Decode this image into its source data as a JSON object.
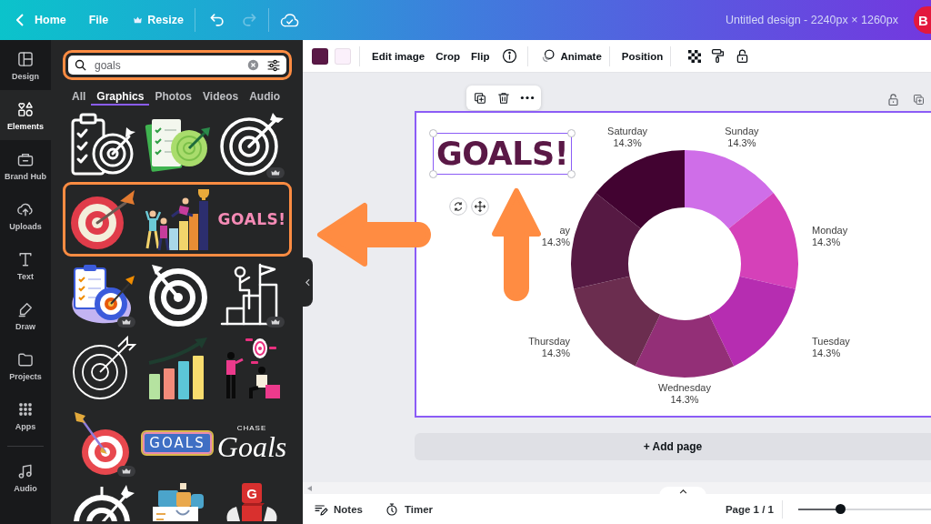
{
  "topbar": {
    "back": "Home",
    "menu": [
      {
        "label": "File"
      }
    ],
    "resize": "Resize",
    "history": [
      {
        "kind": "undo",
        "disabled": false
      },
      {
        "kind": "redo",
        "disabled": true
      }
    ],
    "title": "Untitled design - 2240px × 1260px",
    "avatar": "B"
  },
  "rail": {
    "main": [
      {
        "label": "Design",
        "selected": false
      },
      {
        "label": "Elements",
        "selected": true
      },
      {
        "label": "Brand Hub",
        "selected": false
      },
      {
        "label": "Uploads",
        "selected": false
      },
      {
        "label": "Text",
        "selected": false
      },
      {
        "label": "Draw",
        "selected": false
      },
      {
        "label": "Projects",
        "selected": false
      },
      {
        "label": "Apps",
        "selected": false
      }
    ],
    "extra": [
      {
        "label": "Audio",
        "selected": false
      }
    ]
  },
  "panel": {
    "search": {
      "value": "goals",
      "highlighted": true
    },
    "tabs": [
      {
        "label": "All",
        "selected": false
      },
      {
        "label": "Graphics",
        "selected": true
      },
      {
        "label": "Photos",
        "selected": false
      },
      {
        "label": "Videos",
        "selected": false
      },
      {
        "label": "Audio",
        "selected": false
      }
    ],
    "graphics_rows": [
      {
        "highlighted": false,
        "items": [
          {
            "kind": "clipboard-target",
            "premium": false
          },
          {
            "kind": "paper-target",
            "premium": false
          },
          {
            "kind": "target-outline",
            "premium": true
          }
        ]
      },
      {
        "highlighted": true,
        "items": [
          {
            "kind": "bullseye",
            "premium": false
          },
          {
            "kind": "team-bars",
            "premium": false
          },
          {
            "kind": "lettering",
            "premium": false,
            "text": "GOALS!"
          }
        ]
      },
      {
        "highlighted": false,
        "items": [
          {
            "kind": "blob-clipboard-target",
            "premium": true
          },
          {
            "kind": "target-bold",
            "premium": false
          },
          {
            "kind": "stairs-flag",
            "premium": true
          }
        ]
      },
      {
        "highlighted": false,
        "items": [
          {
            "kind": "target-thin",
            "premium": false
          },
          {
            "kind": "growth-bars",
            "premium": false
          },
          {
            "kind": "people-target",
            "premium": false
          }
        ]
      },
      {
        "highlighted": false,
        "items": [
          {
            "kind": "target-3d",
            "premium": true
          },
          {
            "kind": "badge-lettering",
            "premium": false,
            "text": "GOALS"
          },
          {
            "kind": "script-lettering",
            "premium": false,
            "caption": "CHASE",
            "text": "Goals"
          }
        ]
      },
      {
        "highlighted": false,
        "items": [
          {
            "kind": "target-arrow",
            "premium": false
          },
          {
            "kind": "photo-collage",
            "premium": false
          },
          {
            "kind": "cube-figure",
            "premium": false,
            "text": "G"
          }
        ]
      }
    ]
  },
  "toolbar": {
    "swatches": [
      {
        "color": "#5a1846"
      },
      {
        "color": "#fbf0fb"
      }
    ],
    "actions": [
      {
        "label": "Edit image"
      },
      {
        "label": "Crop"
      },
      {
        "label": "Flip"
      }
    ],
    "animate": "Animate",
    "position": "Position"
  },
  "page": {
    "selected": true,
    "heading": {
      "text": "GOALS!",
      "selected": true
    },
    "chart_data": {
      "type": "donut",
      "categories": [
        "Sunday",
        "Monday",
        "Tuesday",
        "Wednesday",
        "Thursday",
        "ay",
        "Saturday"
      ],
      "series": [
        {
          "values": [
            14.3,
            14.3,
            14.3,
            14.3,
            14.3,
            14.3,
            14.3
          ]
        }
      ],
      "colors": [
        "#cf6ee8",
        "#d541b9",
        "#b62db1",
        "#932f77",
        "#6b2d4f",
        "#561943",
        "#420331"
      ],
      "value_labels": [
        "14.3%",
        "14.3%",
        "14.3%",
        "14.3%",
        "14.3%",
        "14.3%",
        "14.3%"
      ]
    }
  },
  "add_page": "+ Add page",
  "footer": {
    "notes": "Notes",
    "timer": "Timer",
    "page": "Page 1 / 1",
    "zoom": {
      "level": 0.32
    }
  },
  "annotations": [
    {
      "kind": "left-arrow"
    },
    {
      "kind": "up-arrow"
    }
  ]
}
